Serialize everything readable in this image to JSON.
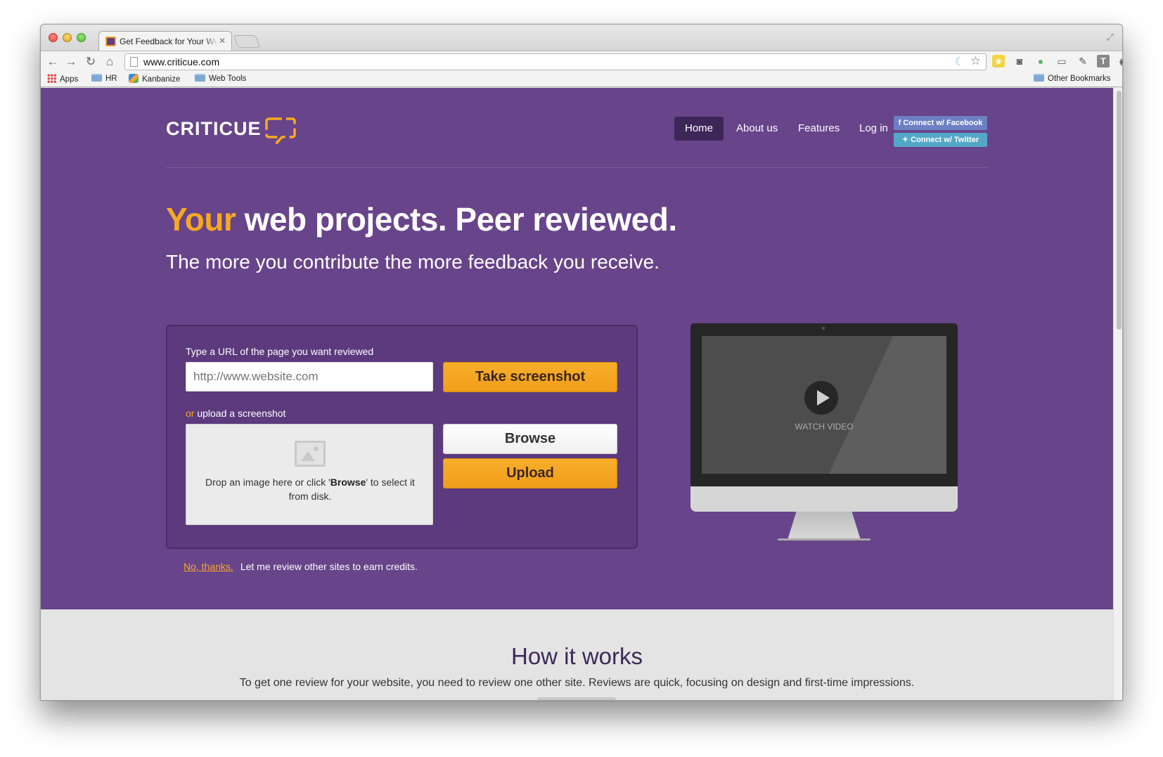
{
  "browser": {
    "tab_title": "Get Feedback for Your Website",
    "url": "www.criticue.com",
    "bookmarks": [
      {
        "label": "Apps"
      },
      {
        "label": "HR"
      },
      {
        "label": "Kanbanize"
      },
      {
        "label": "Web Tools"
      }
    ],
    "other_bookmarks": "Other Bookmarks"
  },
  "site": {
    "logo_text": "CRITICUE",
    "nav": [
      {
        "label": "Home",
        "active": true
      },
      {
        "label": "About us"
      },
      {
        "label": "Features"
      },
      {
        "label": "Log in"
      }
    ],
    "social": {
      "facebook": "f Connect w/ Facebook",
      "twitter": "✦ Connect w/ Twitter"
    }
  },
  "hero": {
    "headline_accent": "Your",
    "headline_rest": " web projects. Peer reviewed.",
    "subheadline": "The more you contribute the more feedback you receive."
  },
  "form": {
    "url_label": "Type a URL of the page you want reviewed",
    "url_placeholder": "http://www.website.com",
    "screenshot_button": "Take screenshot",
    "or_text": "or",
    "upload_label": " upload a screenshot",
    "drop_text_1": "Drop an image here or click '",
    "drop_text_bold": "Browse",
    "drop_text_2": "' to select it from disk.",
    "browse_button": "Browse",
    "upload_button": "Upload",
    "no_thanks_link": "No, thanks.",
    "no_thanks_text": "Let me review other sites to earn credits."
  },
  "video": {
    "label": "WATCH VIDEO"
  },
  "how_it_works": {
    "title": "How it works",
    "description": "To get one review for your website, you need to review one other site. Reviews are quick, focusing on design and first-time impressions."
  },
  "colors": {
    "brand_purple": "#68448a",
    "accent_orange": "#f7a823",
    "nav_active": "#3d2658"
  }
}
